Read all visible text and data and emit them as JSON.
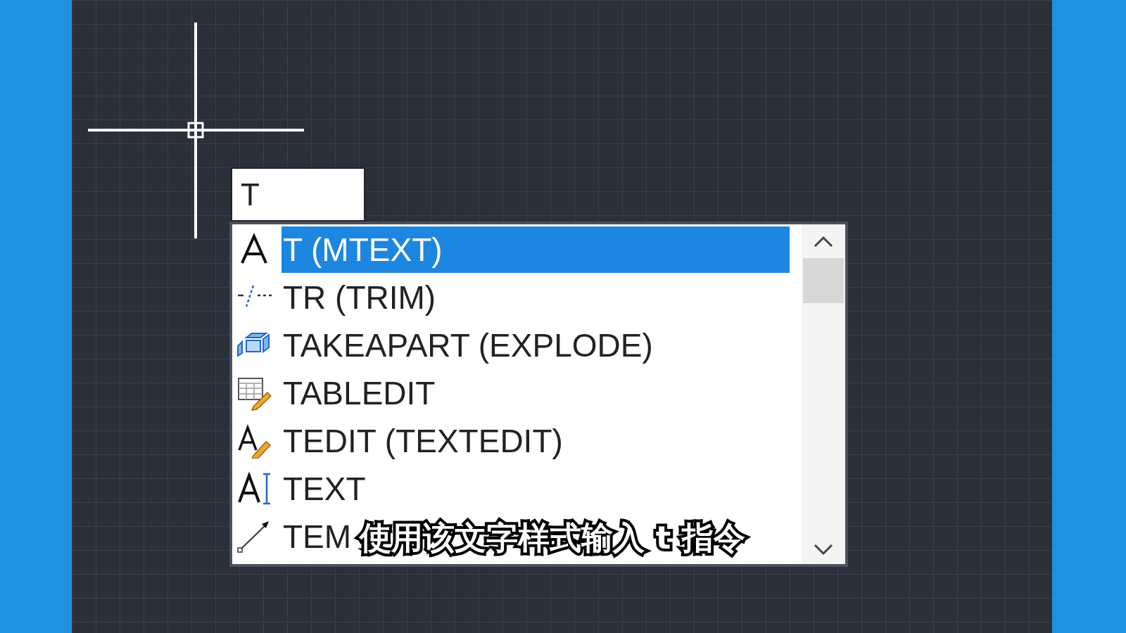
{
  "command_input": {
    "value": "T"
  },
  "suggestions": [
    {
      "label": "T (MTEXT)",
      "kind": "mtext",
      "selected": true
    },
    {
      "label": "TR (TRIM)",
      "kind": "trim",
      "selected": false
    },
    {
      "label": "TAKEAPART (EXPLODE)",
      "kind": "explode",
      "selected": false
    },
    {
      "label": "TABLEDIT",
      "kind": "tabledit",
      "selected": false
    },
    {
      "label": "TEDIT (TEXTEDIT)",
      "kind": "textedit",
      "selected": false
    },
    {
      "label": "TEXT",
      "kind": "text",
      "selected": false
    },
    {
      "label": "TEM",
      "kind": "dimension",
      "selected": false
    }
  ],
  "subtitle": "使用该文字样式输入 t 指令"
}
